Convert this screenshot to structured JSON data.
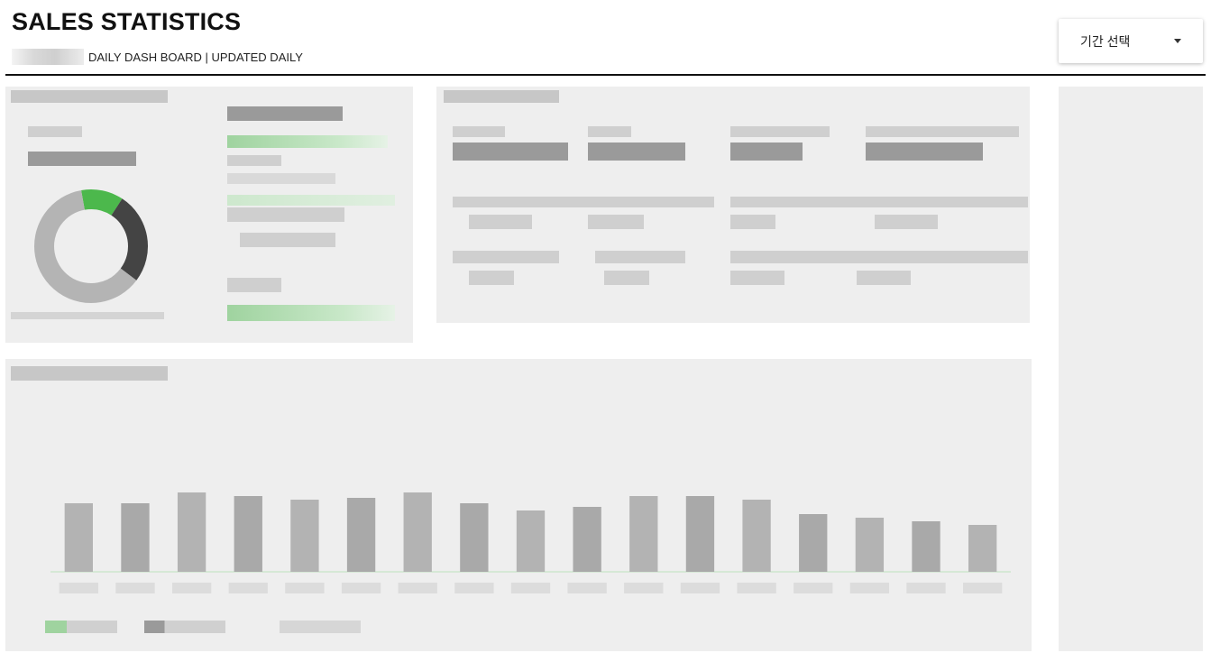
{
  "header": {
    "title": "SALES STATISTICS",
    "subtitle": "DAILY DASH BOARD | UPDATED DAILY"
  },
  "period_select": {
    "label": "기간 선택",
    "icon": "caret-down-icon"
  },
  "colors": {
    "accent_green": "#4cb84c",
    "panel_bg": "#eeeeee",
    "divider": "#111111"
  },
  "chart_data": {
    "type": "bar",
    "title": "",
    "xlabel": "",
    "ylabel": "",
    "categories": [
      "",
      "",
      "",
      "",
      "",
      "",
      "",
      "",
      "",
      "",
      "",
      "",
      "",
      "",
      "",
      "",
      ""
    ],
    "series": [
      {
        "values": [
          38,
          38,
          44,
          42,
          40,
          41,
          44,
          38,
          34,
          36,
          42,
          42,
          40,
          32,
          30,
          28,
          26
        ]
      }
    ],
    "ylim": [
      0,
      100
    ],
    "grid": false,
    "legend": "bottom-left"
  },
  "donut": {
    "segments": [
      {
        "value": 0.12,
        "color": "#4cb84c"
      },
      {
        "value": 0.26,
        "color": "#444444"
      },
      {
        "value": 0.62,
        "color": "#b4b4b4"
      }
    ]
  }
}
